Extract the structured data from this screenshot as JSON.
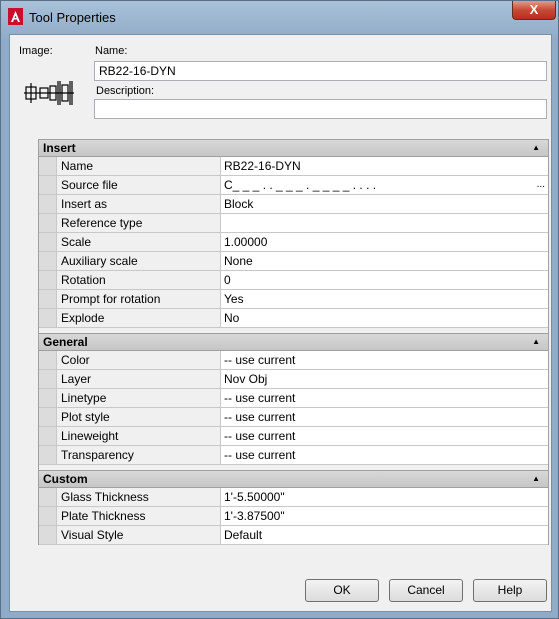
{
  "window": {
    "title": "Tool Properties",
    "close_label": "X"
  },
  "form": {
    "image_label": "Image:",
    "name_label": "Name:",
    "name_value": "RB22-16-DYN",
    "description_label": "Description:",
    "description_value": ""
  },
  "sections": {
    "insert": {
      "title": "Insert",
      "rows": [
        {
          "name": "Name",
          "value": "RB22-16-DYN"
        },
        {
          "name": "Source file",
          "value": "C_ _ _  .  .  _ _ _ .  _ _ _ _  .  .  .  .",
          "has_browse": true
        },
        {
          "name": "Insert as",
          "value": "Block"
        },
        {
          "name": "Reference type",
          "value": ""
        },
        {
          "name": "Scale",
          "value": "1.00000"
        },
        {
          "name": "Auxiliary scale",
          "value": "None"
        },
        {
          "name": "Rotation",
          "value": "0"
        },
        {
          "name": "Prompt for rotation",
          "value": "Yes"
        },
        {
          "name": "Explode",
          "value": "No"
        }
      ]
    },
    "general": {
      "title": "General",
      "rows": [
        {
          "name": "Color",
          "value": "-- use current"
        },
        {
          "name": "Layer",
          "value": "Nov Obj"
        },
        {
          "name": "Linetype",
          "value": "-- use current"
        },
        {
          "name": "Plot style",
          "value": "-- use current"
        },
        {
          "name": "Lineweight",
          "value": "-- use current"
        },
        {
          "name": "Transparency",
          "value": "-- use current"
        }
      ]
    },
    "custom": {
      "title": "Custom",
      "rows": [
        {
          "name": "Glass Thickness",
          "value": "1'-5.50000\""
        },
        {
          "name": "Plate Thickness",
          "value": "1'-3.87500\""
        },
        {
          "name": "Visual Style",
          "value": "Default"
        }
      ]
    }
  },
  "buttons": {
    "ok": "OK",
    "cancel": "Cancel",
    "help": "Help"
  },
  "icons": {
    "collapse": "collapse-arrow-icon",
    "app": "autocad-icon",
    "browse": "ellipsis-icon"
  }
}
